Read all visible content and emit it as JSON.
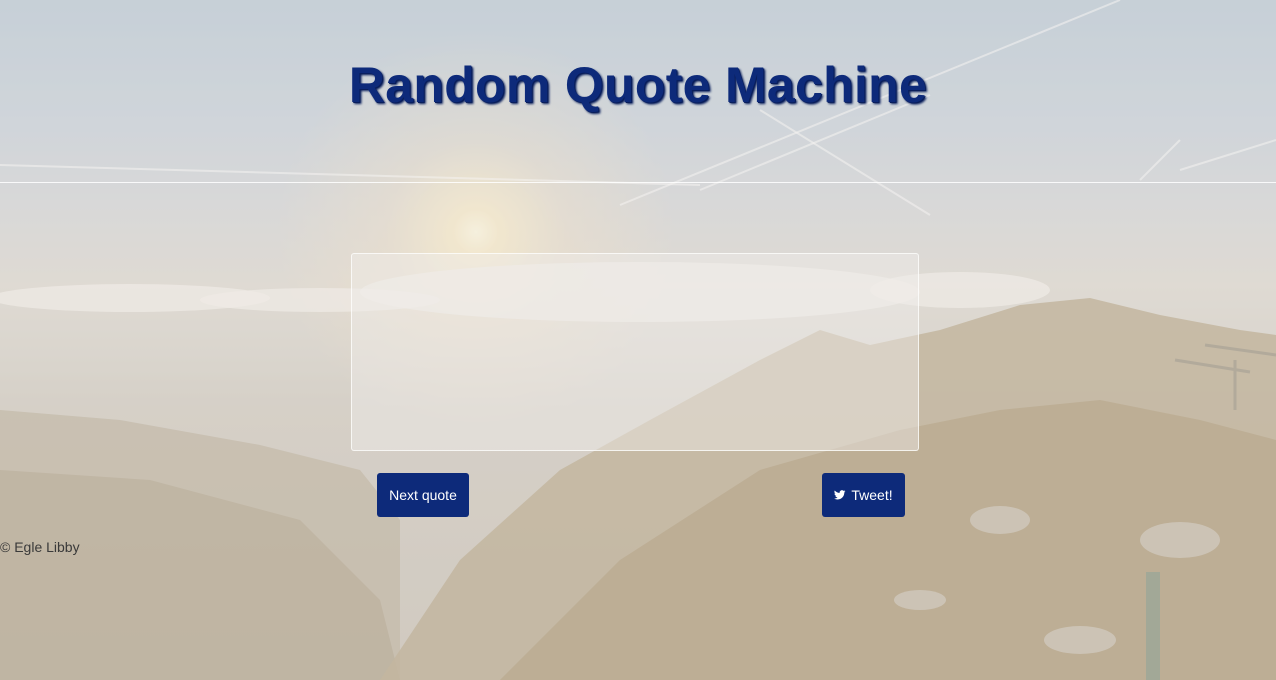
{
  "header": {
    "title": "Random Quote Machine"
  },
  "quote": {
    "text": ""
  },
  "actions": {
    "next_label": "Next quote",
    "tweet_label": "Tweet!",
    "tweet_icon": "twitter-bird-icon"
  },
  "footer": {
    "text": "© Egle Libby"
  },
  "colors": {
    "accent": "#0d2a7a",
    "button_text": "#ffffff"
  }
}
